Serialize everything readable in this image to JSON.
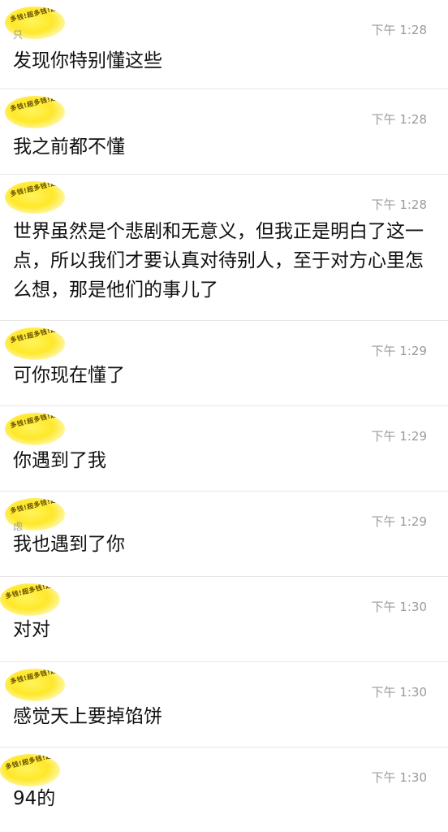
{
  "avatar_text": "多钱!超多钱!超多钱!超多钱!超",
  "messages": [
    {
      "name": "只",
      "time": "下午 1:28",
      "text": "发现你特别懂这些"
    },
    {
      "name": "",
      "time": "下午 1:28",
      "text": "我之前都不懂"
    },
    {
      "name": "",
      "time": "下午 1:28",
      "text": "世界虽然是个悲剧和无意义，但我正是明白了这一点，所以我们才要认真对待别人，至于对方心里怎么想，那是他们的事儿了"
    },
    {
      "name": "",
      "time": "下午 1:29",
      "text": "可你现在懂了"
    },
    {
      "name": "",
      "time": "下午 1:29",
      "text": "你遇到了我"
    },
    {
      "name": "虑",
      "time": "下午 1:29",
      "text": "我也遇到了你"
    },
    {
      "name": "",
      "time": "下午 1:30",
      "text": "对对"
    },
    {
      "name": "",
      "time": "下午 1:30",
      "text": "感觉天上要掉馅饼"
    },
    {
      "name": "",
      "time": "下午 1:30",
      "text": "94的"
    }
  ]
}
